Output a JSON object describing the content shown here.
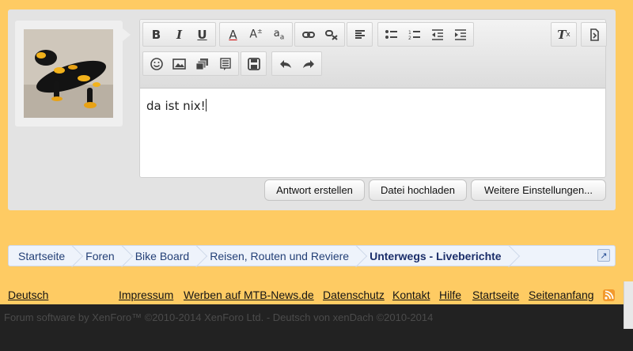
{
  "editor": {
    "content": "da ist nix!",
    "toolbar_row1": [
      "bold-icon",
      "italic-icon",
      "underline-icon",
      "font-color-icon",
      "font-size-icon",
      "font-family-icon",
      "link-icon",
      "unlink-icon",
      "align-icon",
      "bullet-list-icon",
      "number-list-icon",
      "outdent-icon",
      "indent-icon",
      "remove-format-icon",
      "toggle-bbcode-icon"
    ],
    "toolbar_row2": [
      "smilie-icon",
      "image-icon",
      "media-icon",
      "quote-icon",
      "save-draft-icon",
      "undo-icon",
      "redo-icon"
    ]
  },
  "actions": {
    "reply_label": "Antwort erstellen",
    "upload_label": "Datei hochladen",
    "more_label": "Weitere Einstellungen..."
  },
  "breadcrumb": {
    "items": [
      "Startseite",
      "Foren",
      "Bike Board",
      "Reisen, Routen und Reviere",
      "Unterwegs - Liveberichte"
    ]
  },
  "footer": {
    "language": "Deutsch",
    "links": [
      "Impressum",
      "Werben auf MTB-News.de",
      "Datenschutz",
      "Kontakt",
      "Hilfe",
      "Startseite",
      "Seitenanfang"
    ],
    "copyright": "Forum software by XenForo™ ©2010-2014 XenForo Ltd. - Deutsch von xenDach ©2010-2014"
  },
  "colors": {
    "page": "#fecb63",
    "panel": "#e3e3e3",
    "crumb_text": "#233f76",
    "footer_bg": "#222222"
  }
}
